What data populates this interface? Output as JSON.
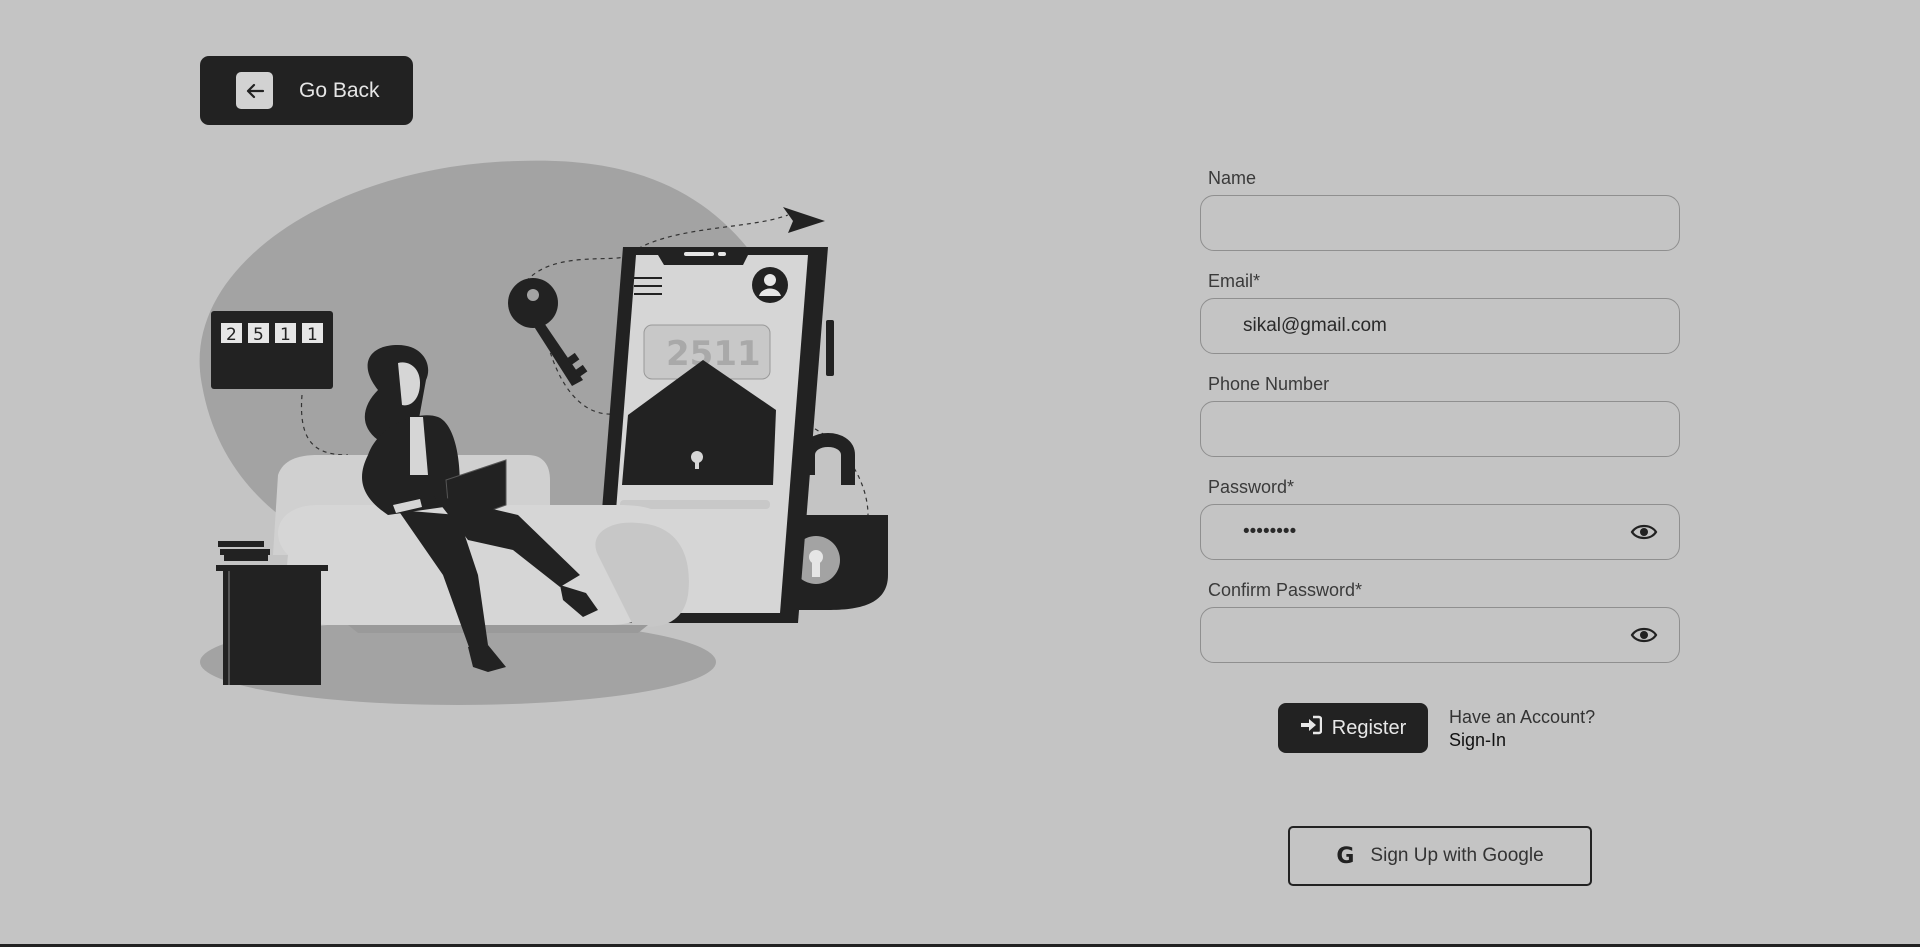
{
  "header": {
    "go_back_label": "Go Back",
    "go_back_icon": "arrow-left-icon"
  },
  "illustration": {
    "combo_lock_digits": [
      "2",
      "5",
      "1",
      "1"
    ],
    "phone_code": "2511"
  },
  "form": {
    "name": {
      "label": "Name",
      "value": "",
      "placeholder": ""
    },
    "email": {
      "label": "Email*",
      "value": "sikal@gmail.com",
      "placeholder": ""
    },
    "phone": {
      "label": "Phone Number",
      "value": "",
      "placeholder": ""
    },
    "password": {
      "label": "Password*",
      "value": "••••••••",
      "placeholder": "",
      "toggle_icon": "eye-icon"
    },
    "confirm_password": {
      "label": "Confirm Password*",
      "value": "",
      "placeholder": "",
      "toggle_icon": "eye-icon"
    }
  },
  "actions": {
    "register_label": "Register",
    "register_icon": "sign-in-icon",
    "have_account_text": "Have an Account?",
    "sign_in_label": "Sign-In",
    "google_label": "Sign Up with Google",
    "google_icon": "google-g-icon"
  },
  "colors": {
    "background": "#c4c4c4",
    "dark": "#222222",
    "field_border": "#8f8f8f"
  }
}
